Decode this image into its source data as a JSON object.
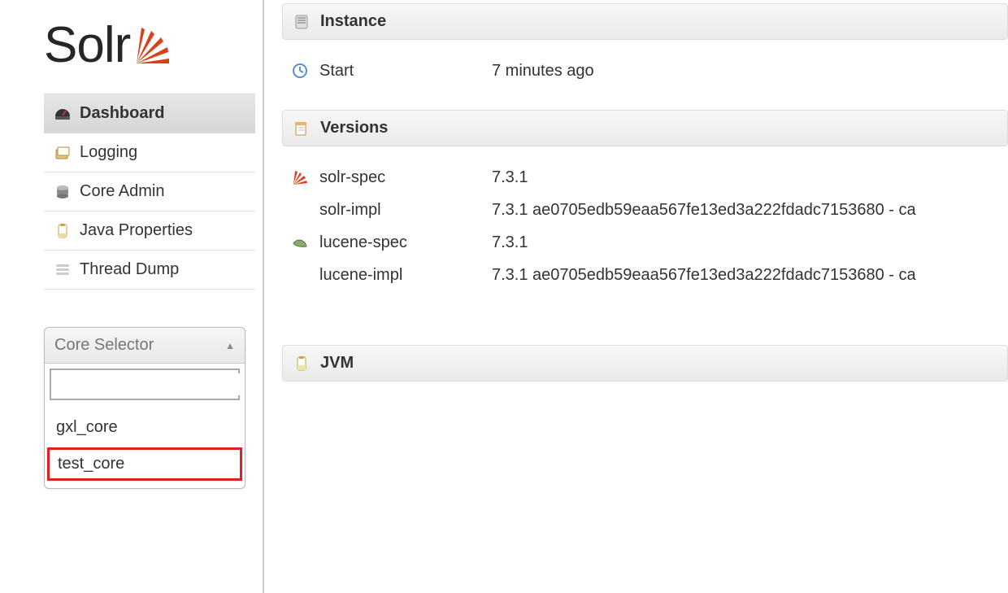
{
  "logo": {
    "text": "Solr"
  },
  "nav": {
    "items": [
      {
        "label": "Dashboard",
        "active": true
      },
      {
        "label": "Logging",
        "active": false
      },
      {
        "label": "Core Admin",
        "active": false
      },
      {
        "label": "Java Properties",
        "active": false
      },
      {
        "label": "Thread Dump",
        "active": false
      }
    ]
  },
  "core_selector": {
    "title": "Core Selector",
    "search_placeholder": "",
    "cores": [
      {
        "name": "gxl_core",
        "highlighted": false
      },
      {
        "name": "test_core",
        "highlighted": true
      }
    ]
  },
  "instance": {
    "header": "Instance",
    "start_label": "Start",
    "start_value": "7 minutes ago"
  },
  "versions": {
    "header": "Versions",
    "rows": [
      {
        "label": "solr-spec",
        "value": "7.3.1",
        "icon": "solr"
      },
      {
        "label": "solr-impl",
        "value": "7.3.1 ae0705edb59eaa567fe13ed3a222fdadc7153680 - ca",
        "icon": ""
      },
      {
        "label": "lucene-spec",
        "value": "7.3.1",
        "icon": "lucene"
      },
      {
        "label": "lucene-impl",
        "value": "7.3.1 ae0705edb59eaa567fe13ed3a222fdadc7153680 - ca",
        "icon": ""
      }
    ]
  },
  "jvm": {
    "header": "JVM"
  }
}
